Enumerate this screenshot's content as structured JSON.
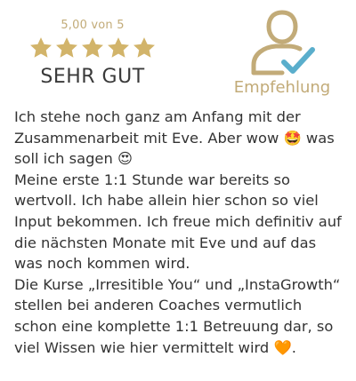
{
  "rating": {
    "score_text": "5,00 von 5",
    "stars": 5,
    "star_color": "#d2b46a",
    "label": "SEHR GUT"
  },
  "recommendation": {
    "icon": "user-check-icon",
    "icon_color_person": "#c2ab78",
    "icon_color_check": "#5aaecc",
    "label": "Empfehlung"
  },
  "review": {
    "lines": [
      "Ich stehe noch ganz am Anfang mit der Zusammenarbeit mit Eve. Aber wow 🤩 was soll ich sagen 😍",
      "Meine erste 1:1 Stunde war bereits so wertvoll. Ich habe allein hier schon so viel Input bekommen. Ich freue mich definitiv auf die nächsten Monate mit Eve und auf das was noch kommen wird.",
      "Die Kurse „Irresitible You“ und „InstaGrowth“ stellen bei anderen Coaches vermutlich schon eine komplette 1:1 Betreuung dar, so viel Wissen wie hier vermittelt wird 🧡."
    ]
  }
}
